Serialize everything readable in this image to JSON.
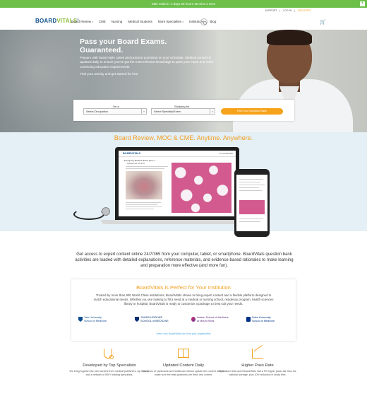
{
  "promo": {
    "text": "Sale ends in: 2 days 23 hours 15 mins 2 secs",
    "close_icon": "plus-icon"
  },
  "utility": {
    "support": "SUPPORT",
    "login": "LOG IN",
    "register": "REGISTER",
    "sep": "|"
  },
  "header": {
    "logo_main": "BOARD",
    "logo_v": "VITALS",
    "logo_reg": "®",
    "logo_tagline": "by ...",
    "nav": [
      {
        "label": "Board Review",
        "caret": "▾"
      },
      {
        "label": "CME",
        "caret": ""
      },
      {
        "label": "Nursing",
        "caret": ""
      },
      {
        "label": "Medical Students",
        "caret": ""
      },
      {
        "label": "More Specialties",
        "caret": "▾"
      },
      {
        "label": "Institutions",
        "caret": ""
      },
      {
        "label": "Blog",
        "caret": ""
      }
    ],
    "search_icon": "search-icon",
    "cart_icon": "cart-icon"
  },
  "hero": {
    "headline": "Pass your Board Exams. Guaranteed.",
    "description": "Prepare with board-style cases and practice questions on your schedule. Medical content is updated daily to ensure you've got the most relevant knowledge to pass your exam and meet continuing education requirements.",
    "cta_text": "Find your activity and get started for free."
  },
  "finder": {
    "occupation_label": "I'm a",
    "occupation_value": "Select Occupation",
    "studying_label": "Studying for",
    "studying_value": "Select Specialty/Exam",
    "button": "Find Your Question Bank"
  },
  "devices": {
    "heading": "Board Review, MOC & CME. Anytime. Anywhere.",
    "screen_logo": "BOARDVITALS",
    "screen_account": "MY DASHBOARD",
    "screen_title": "Emergency Medicine Exam (EU) 1 ...",
    "screen_question": "Question 22 out of 40"
  },
  "intro": {
    "text": "Get access to expert content online 24/7/365 from your computer, tablet, or smartphone. BoardVitals question bank activities are loaded with detailed explanations, reference materials, and evidence-based rationales to make learning and preparation more effective (and more fun)."
  },
  "institution": {
    "heading": "BoardVitals is Perfect for Your Institution",
    "text": "Trusted by more than 900 World Class institutions, BoardVitals strives to bring expert content and a flexible platform designed to match educational needs. Whether you are looking to fill a need at a medical or nursing school, residency program, health sciences library or hospital, BoardVitals is ready to customize a package to best suit your needs.",
    "logos": [
      {
        "line1": "Yale University",
        "line2": "School of Medicine"
      },
      {
        "line1": "JOHNS HOPKINS",
        "line2": "SCHOOL of MEDICINE"
      },
      {
        "line1": "Avalon School of Medicine",
        "line2": "at Mount Sinai"
      },
      {
        "line1": "Duke University",
        "line2": "School of Medicine"
      }
    ],
    "learn_more": "Learn how BoardVitals can help your organization"
  },
  "features": [
    {
      "icon": "stethoscope-icon",
      "title": "Developed by Top Specialists",
      "text": "We bring together the best content from medical publishers, top faculty, and a network of 500+ leading specialists."
    },
    {
      "icon": "book-icon",
      "title": "Updated Content Daily",
      "text": "Our team of physicians and healthcare editors update the content daily to make sure the best questions are fresh and current."
    },
    {
      "icon": "chart-icon",
      "title": "Higher Pass Rate",
      "text": "Test takers that used BoardVitals had a 9% higher pass rate than the national average, plus 10% reduction in study time."
    }
  ],
  "colors": {
    "accent_orange": "#f29f1f",
    "promo_green": "#6cc04a",
    "brand_blue": "#0d4e8c"
  }
}
